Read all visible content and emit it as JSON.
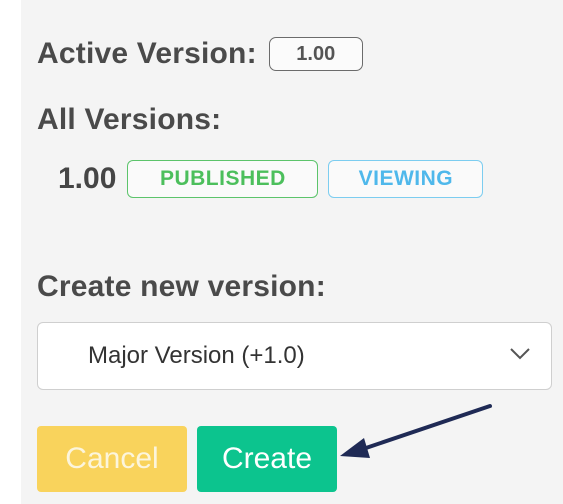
{
  "active_version": {
    "label": "Active Version:",
    "value": "1.00"
  },
  "all_versions": {
    "label": "All Versions:",
    "items": [
      {
        "version": "1.00",
        "badges": [
          {
            "text": "PUBLISHED",
            "color": "#4cbf5c"
          },
          {
            "text": "VIEWING",
            "color": "#4fb8eb"
          }
        ]
      }
    ]
  },
  "create_new_version": {
    "label": "Create new version:",
    "selected_option": "Major Version (+1.0)",
    "dropdown_icon": "chevron-down-icon"
  },
  "buttons": {
    "cancel_label": "Cancel",
    "create_label": "Create"
  },
  "annotation": {
    "icon": "arrow-pointer-icon",
    "color": "#1f2a55"
  },
  "colors": {
    "cancel_button": "#f9d35c",
    "create_button": "#0cc48e",
    "panel_background": "#f4f4f4"
  }
}
